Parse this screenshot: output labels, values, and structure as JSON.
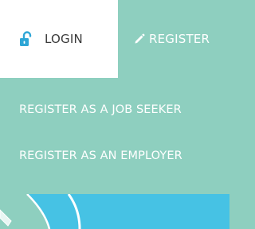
{
  "tabs": {
    "login": {
      "label": "LOGIN",
      "icon": "unlock-icon"
    },
    "register": {
      "label": "REGISTER",
      "icon": "pencil-icon"
    }
  },
  "register_menu": {
    "items": [
      {
        "label": "REGISTER AS A JOB SEEKER"
      },
      {
        "label": "REGISTER AS AN EMPLOYER"
      }
    ]
  },
  "colors": {
    "panel_background": "#8ecfbf",
    "login_tab_background": "#ffffff",
    "accent_blue": "#2ea6d6",
    "bottom_background": "#46c2e4",
    "text_light": "#ffffff",
    "text_dark": "#3a3a3a"
  }
}
